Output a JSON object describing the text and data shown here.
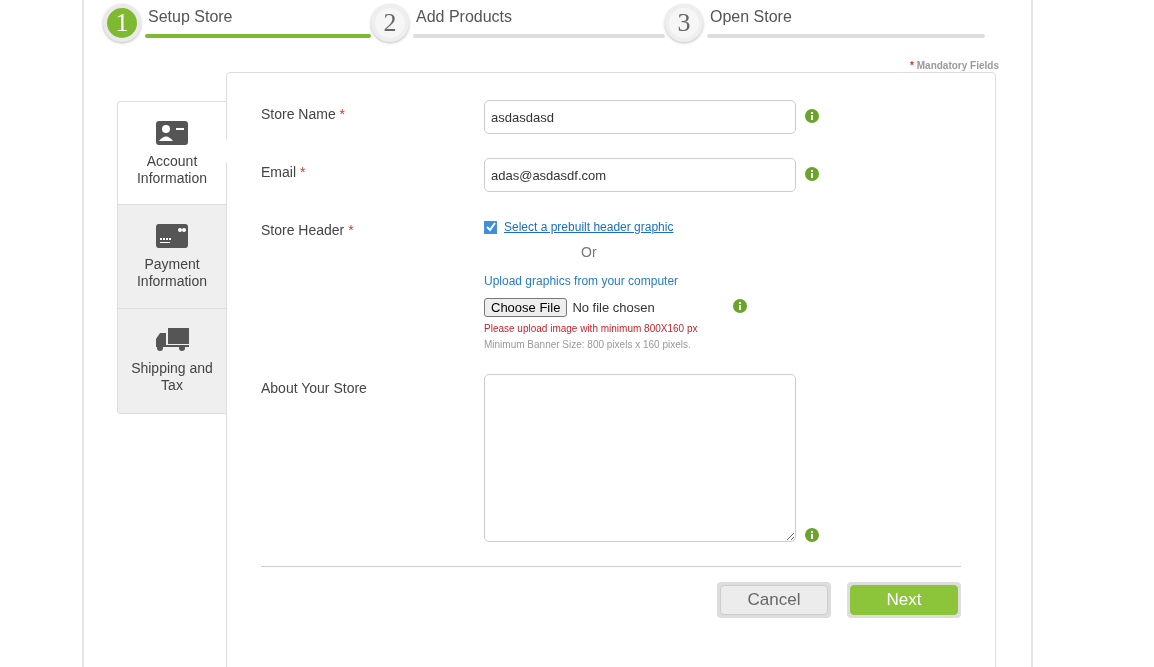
{
  "steps": [
    {
      "number": "1",
      "label": "Setup Store",
      "selected": true
    },
    {
      "number": "2",
      "label": "Add Products",
      "selected": false
    },
    {
      "number": "3",
      "label": "Open Store",
      "selected": false
    }
  ],
  "mandatory_note": {
    "mark": "*",
    "text": "Mandatory Fields"
  },
  "side_tabs": [
    {
      "kind": "account",
      "label": "Account Information",
      "selected": true
    },
    {
      "kind": "payment",
      "label": "Payment Information",
      "selected": false
    },
    {
      "kind": "shipping",
      "label": "Shipping and Tax",
      "selected": false
    }
  ],
  "fields": [
    {
      "label": "Store Name",
      "required_mark": "*",
      "value": "asdasdasd"
    },
    {
      "label": "Email",
      "required_mark": "*",
      "value": "adas@asdasdf.com"
    }
  ],
  "store_header": {
    "label": "Store Header",
    "required_mark": "*",
    "prebuilt_checked": true,
    "prebuilt_link": "Select a prebuilt header graphic",
    "or_text": "Or",
    "upload_text": "Upload graphics from your computer",
    "choose_button": "Choose File",
    "file_status": "No file chosen",
    "error": "Please upload image with minimum 800X160 px",
    "hint": "Minimum Banner Size: 800 pixels x 160 pixels."
  },
  "about": {
    "label": "About Your Store"
  },
  "buttons": {
    "cancel": "Cancel",
    "next": "Next"
  }
}
